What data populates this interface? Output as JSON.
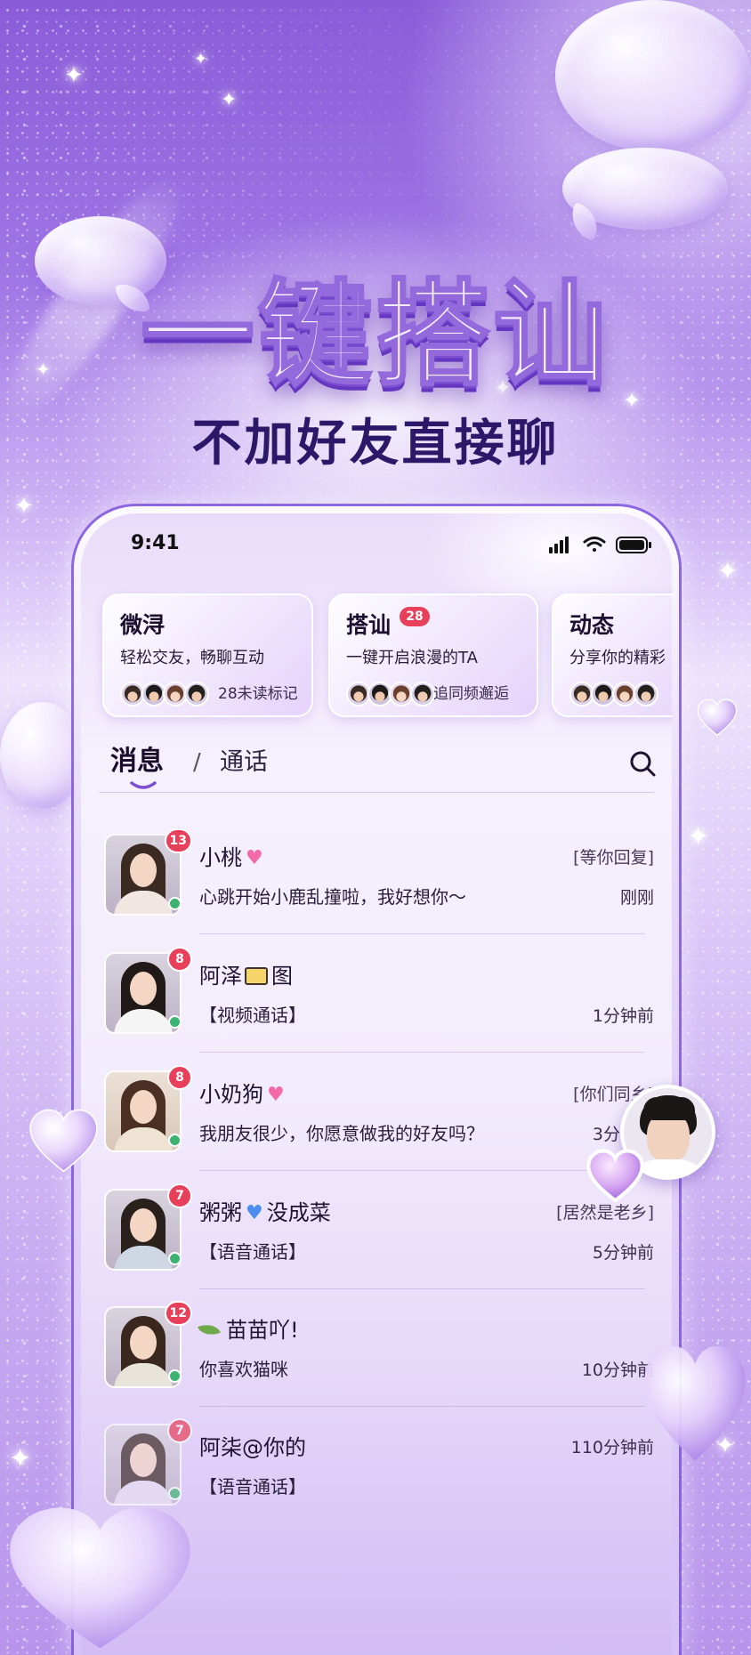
{
  "hero": {
    "title": "一键搭讪",
    "subtitle": "不加好友直接聊"
  },
  "status_bar": {
    "time": "9:41",
    "icons": [
      "signal-icon",
      "wifi-icon",
      "battery-icon"
    ]
  },
  "cards": [
    {
      "title": "微浔",
      "desc": "轻松交友，畅聊互动",
      "note": "28未读标记"
    },
    {
      "title": "搭讪",
      "badge": "28",
      "desc": "一键开启浪漫的TA",
      "note": "追同频邂逅"
    },
    {
      "title": "动态",
      "desc": "分享你的精彩"
    }
  ],
  "tabs": {
    "messages": "消息",
    "separator": "/",
    "calls": "通话",
    "search_icon": "search-icon"
  },
  "conversations": [
    {
      "unread": "13",
      "name": "小桃",
      "name_icon": "pink-heart-icon",
      "tag": "[等你回复]",
      "preview": "心跳开始小鹿乱撞啦，我好想你～",
      "time": "刚刚"
    },
    {
      "unread": "8",
      "name": "阿泽",
      "name_icon": "envelope-icon",
      "name_suffix": "图",
      "preview": "【视频通话】",
      "time": "1分钟前"
    },
    {
      "unread": "8",
      "name": "小奶狗",
      "name_icon": "pink-heart-icon",
      "tag": "[你们同乡]",
      "preview": "我朋友很少，你愿意做我的好友吗？",
      "time": "3分钟前"
    },
    {
      "unread": "7",
      "name": "粥粥",
      "name_icon": "blue-heart-icon",
      "name_suffix": "没成菜",
      "tag": "[居然是老乡]",
      "preview": "【语音通话】",
      "time": "5分钟前"
    },
    {
      "unread": "12",
      "name_icon": "leaf-icon",
      "name": "苗苗吖!",
      "preview": "你喜欢猫咪",
      "time": "10分钟前"
    },
    {
      "unread": "7",
      "name": "阿柒@你的",
      "time": "110分钟前",
      "preview": "【语音通话】"
    }
  ],
  "colors": {
    "accent": "#7b4fd0",
    "badge": "#e8405a",
    "online": "#3cb371",
    "subtitle": "#2b1868"
  }
}
